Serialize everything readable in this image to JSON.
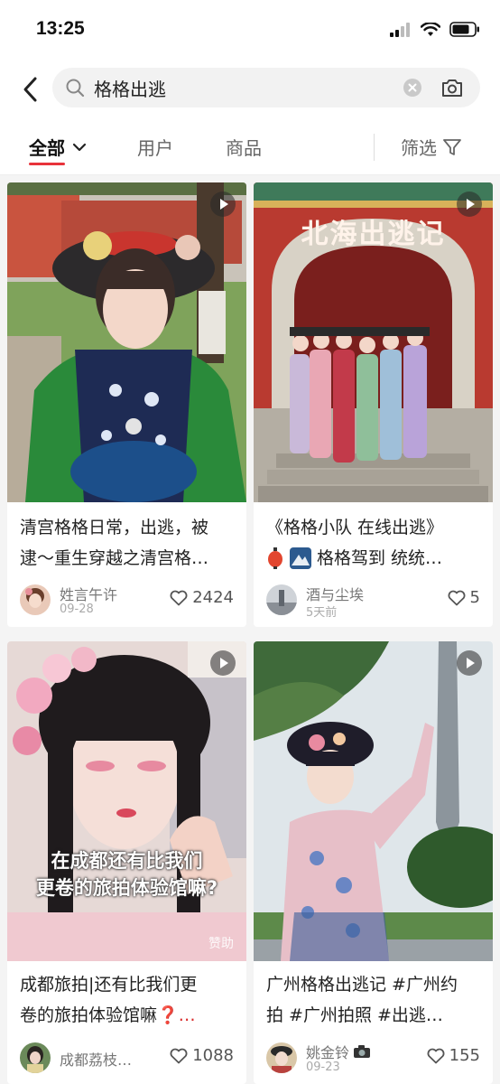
{
  "status": {
    "time": "13:25"
  },
  "search": {
    "query": "格格出逃"
  },
  "tabs": {
    "all": "全部",
    "users": "用户",
    "products": "商品",
    "filter": "筛选"
  },
  "cards": [
    {
      "title_line1": "清宫格格日常，出逃，被",
      "title_line2": "逮～重生穿越之清宫格…",
      "author": "姓言午许",
      "date": "09-28",
      "likes": "2424"
    },
    {
      "overlay": "北海出逃记",
      "title_line1": "《格格小队 在线出逃》",
      "title_line2": "格格驾到 统统…",
      "author": "酒与尘埃",
      "date": "5天前",
      "likes": "5"
    },
    {
      "overlay_line1": "在成都还有比我们",
      "overlay_line2": "更卷的旅拍体验馆嘛?",
      "sponsor": "赞助",
      "title_line1": "成都旅拍|还有比我们更",
      "title_line2": "卷的旅拍体验馆嘛",
      "title_line2_suffix": "❓…",
      "author": "成都荔枝…",
      "likes": "1088"
    },
    {
      "title_line1": "广州格格出逃记 #广州约",
      "title_line2": "拍 #广州拍照 #出逃…",
      "author": "姚金铃",
      "date": "09-23",
      "likes": "155"
    }
  ],
  "colors": {
    "accent": "#e8333b",
    "background": "#f4f4f4"
  },
  "icons": [
    "back-icon",
    "search-icon",
    "clear-icon",
    "camera-icon",
    "chevron-down-icon",
    "filter-icon",
    "play-icon",
    "heart-icon",
    "wifi-icon",
    "battery-icon",
    "signal-icon"
  ]
}
